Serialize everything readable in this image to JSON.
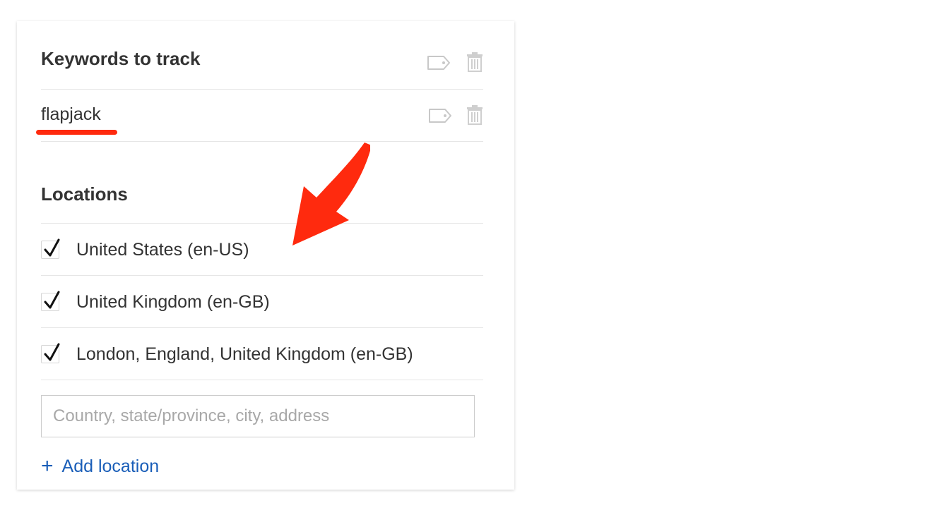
{
  "keywords_section": {
    "heading": "Keywords to track",
    "tag_icon": "tag-icon",
    "delete_icon": "trash-icon"
  },
  "keywords": [
    {
      "text": "flapjack"
    }
  ],
  "locations_section": {
    "heading": "Locations",
    "items": [
      {
        "label": "United States (en-US)",
        "checked": true
      },
      {
        "label": "United Kingdom (en-GB)",
        "checked": true
      },
      {
        "label": "London, England, United Kingdom (en-GB)",
        "checked": true
      }
    ],
    "input": {
      "value": "",
      "placeholder": "Country, state/province, city, address"
    },
    "add_label": "Add location",
    "add_icon": "plus-icon"
  },
  "colors": {
    "annotation_red": "#ff2a0e",
    "link_blue": "#1a5eb8",
    "text": "#333333"
  }
}
